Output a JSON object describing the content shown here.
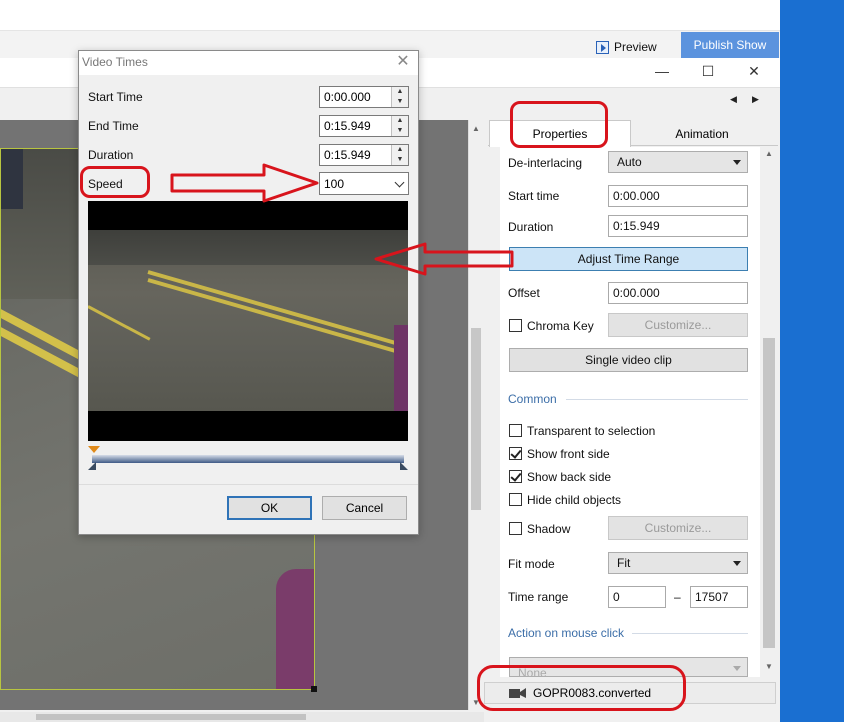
{
  "toolbar": {
    "preview_label": "Preview",
    "publish_label": "Publish Show"
  },
  "window_controls": {
    "minimize": "—",
    "maximize": "☐",
    "close": "✕"
  },
  "nav": {
    "prev": "◀",
    "next": "▶"
  },
  "dialog": {
    "title": "Video Times",
    "close": "✕",
    "start_time_label": "Start Time",
    "start_time_value": "0:00.000",
    "end_time_label": "End Time",
    "end_time_value": "0:15.949",
    "duration_label": "Duration",
    "duration_value": "0:15.949",
    "speed_label": "Speed",
    "speed_value": "100",
    "ok_label": "OK",
    "cancel_label": "Cancel"
  },
  "properties": {
    "tabs": [
      "Properties",
      "Animation"
    ],
    "deinterlacing_label": "De-interlacing",
    "deinterlacing_value": "Auto",
    "start_time_label": "Start time",
    "start_time_value": "0:00.000",
    "duration_label": "Duration",
    "duration_value": "0:15.949",
    "adjust_time_range_label": "Adjust Time Range",
    "offset_label": "Offset",
    "offset_value": "0:00.000",
    "chroma_key_label": "Chroma Key",
    "chroma_key_checked": false,
    "customize_label": "Customize...",
    "single_video_clip_label": "Single video clip",
    "common_section": "Common",
    "transparent_label": "Transparent to selection",
    "show_front_label": "Show front side",
    "show_back_label": "Show back side",
    "hide_child_label": "Hide child objects",
    "shadow_label": "Shadow",
    "shadow_customize_label": "Customize...",
    "fit_mode_label": "Fit mode",
    "fit_mode_value": "Fit",
    "time_range_label": "Time range",
    "time_range_from": "0",
    "time_range_dash": "–",
    "time_range_to": "17507",
    "action_section": "Action on mouse click",
    "action_value": "None"
  },
  "object_bar": {
    "name": "GOPR0083.converted"
  },
  "colors": {
    "annotation_red": "#d8141c",
    "publish_blue": "#5b93de",
    "desktop_blue": "#1a6fd1",
    "section_blue": "#3c6ea8"
  }
}
